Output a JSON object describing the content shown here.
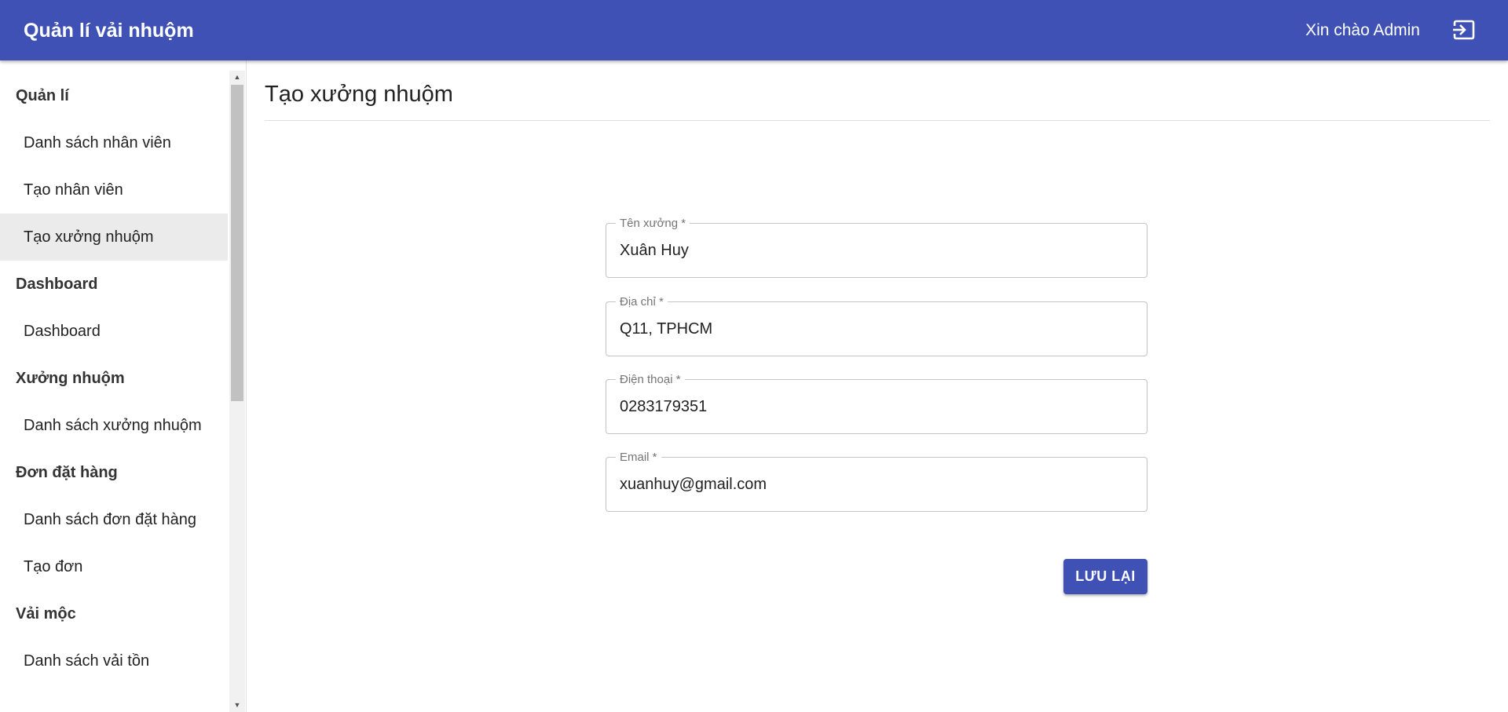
{
  "header": {
    "app_title": "Quản lí vải nhuộm",
    "greeting": "Xin chào Admin",
    "logout_icon": "logout-icon",
    "background_color": "#3f51b5"
  },
  "sidebar": {
    "sections": [
      {
        "title": "Quản lí",
        "items": [
          {
            "label": "Danh sách nhân viên",
            "active": false
          },
          {
            "label": "Tạo nhân viên",
            "active": false
          },
          {
            "label": "Tạo xưởng nhuộm",
            "active": true
          }
        ]
      },
      {
        "title": "Dashboard",
        "items": [
          {
            "label": "Dashboard",
            "active": false
          }
        ]
      },
      {
        "title": "Xưởng nhuộm",
        "items": [
          {
            "label": "Danh sách xưởng nhuộm",
            "active": false
          }
        ]
      },
      {
        "title": "Đơn đặt hàng",
        "items": [
          {
            "label": "Danh sách đơn đặt hàng",
            "active": false
          },
          {
            "label": "Tạo đơn",
            "active": false
          }
        ]
      },
      {
        "title": "Vải mộc",
        "items": [
          {
            "label": "Danh sách vải tồn",
            "active": false
          }
        ]
      }
    ]
  },
  "main": {
    "page_title": "Tạo xưởng nhuộm",
    "form": {
      "name": {
        "label": "Tên xưởng *",
        "value": "Xuân Huy"
      },
      "address": {
        "label": "Địa chỉ *",
        "value": "Q11, TPHCM"
      },
      "phone": {
        "label": "Điện thoại *",
        "value": "0283179351"
      },
      "email": {
        "label": "Email *",
        "value": "xuanhuy@gmail.com"
      },
      "save_label": "LƯU LẠI"
    }
  }
}
